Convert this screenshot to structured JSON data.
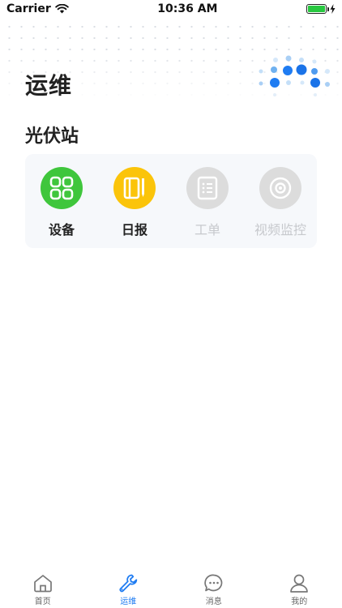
{
  "status_bar": {
    "carrier": "Carrier",
    "time": "10:36 AM",
    "battery_level": 1.0
  },
  "page": {
    "title": "运维"
  },
  "section": {
    "title": "光伏站"
  },
  "grid_items": [
    {
      "label": "设备",
      "icon": "grid-icon",
      "color": "#3fc63c",
      "enabled": true
    },
    {
      "label": "日报",
      "icon": "report-icon",
      "color": "#fbc40a",
      "enabled": true
    },
    {
      "label": "工单",
      "icon": "list-icon",
      "color": "#dcdcdc",
      "enabled": false
    },
    {
      "label": "视频监控",
      "icon": "camera-icon",
      "color": "#dcdcdc",
      "enabled": false
    }
  ],
  "tab_bar": {
    "tabs": [
      {
        "label": "首页",
        "icon": "home-icon",
        "active": false
      },
      {
        "label": "运维",
        "icon": "wrench-icon",
        "active": true
      },
      {
        "label": "消息",
        "icon": "message-icon",
        "active": false
      },
      {
        "label": "我的",
        "icon": "person-icon",
        "active": false
      }
    ]
  },
  "colors": {
    "accent": "#1f7cf2",
    "text": "#222222",
    "disabled": "#c7c9cd"
  }
}
